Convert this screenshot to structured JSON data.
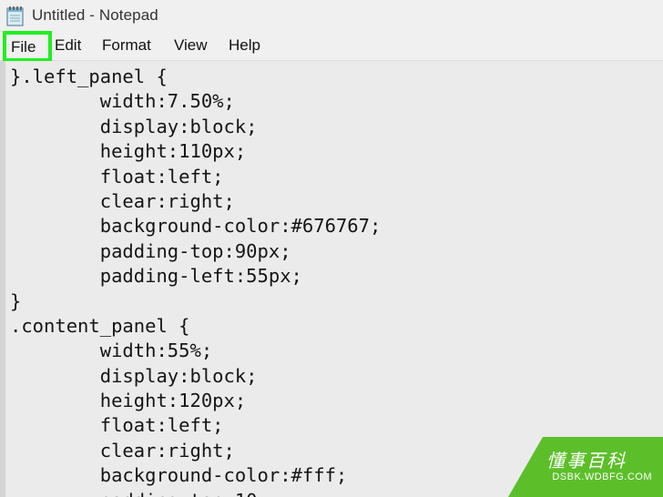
{
  "window": {
    "title": "Untitled - Notepad",
    "app_icon": "notepad-icon"
  },
  "menu": {
    "items": [
      {
        "label": "File",
        "highlighted": true
      },
      {
        "label": "Edit"
      },
      {
        "label": "Format"
      },
      {
        "label": "View"
      },
      {
        "label": "Help"
      }
    ]
  },
  "editor": {
    "lines": [
      "}.left_panel {",
      "        width:7.50%;",
      "        display:block;",
      "        height:110px;",
      "        float:left;",
      "        clear:right;",
      "        background-color:#676767;",
      "        padding-top:90px;",
      "        padding-left:55px;",
      "}",
      ".content_panel {",
      "        width:55%;",
      "        display:block;",
      "        height:120px;",
      "        float:left;",
      "        clear:right;",
      "        background-color:#fff;",
      "        padding-top:10"
    ]
  },
  "watermark": {
    "title": "懂事百科",
    "subtitle": "DSBK.WDBFG.COM"
  },
  "colors": {
    "highlight": "#22ee22",
    "watermark_green": "#5cbf2a"
  }
}
